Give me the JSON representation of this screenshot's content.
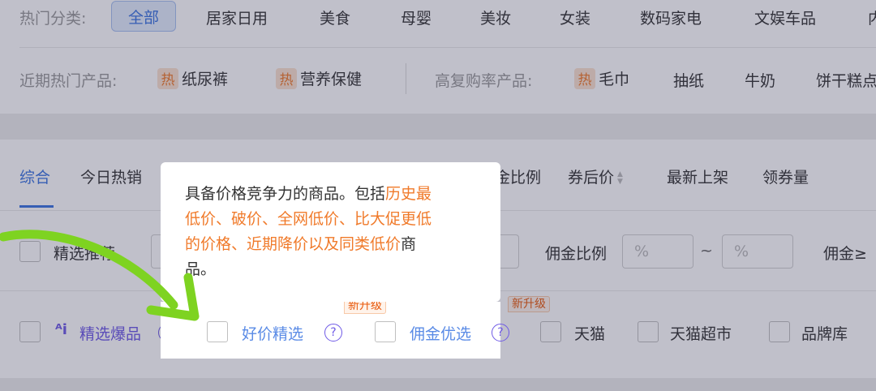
{
  "categories": {
    "label": "热门分类:",
    "items": [
      "全部",
      "居家日用",
      "美食",
      "母婴",
      "美妆",
      "女装",
      "数码家电",
      "文娱车品",
      "内"
    ]
  },
  "hot_products": {
    "recent_label": "近期热门产品:",
    "hot_badge": "热",
    "recent_items": [
      "纸尿裤",
      "营养保健"
    ],
    "repurchase_label": "高复购率产品:",
    "repurchase_items": [
      "毛巾",
      "抽纸",
      "牛奶",
      "饼干糕点"
    ]
  },
  "sort_tabs": [
    "综合",
    "今日热销",
    "金比例",
    "券后价",
    "最新上架",
    "领券量"
  ],
  "filter_row1": {
    "recommend_label": "精选推荐",
    "commission_ratio_label": "佣金比例",
    "percent_placeholder": "%",
    "range_sep": "~",
    "commission_gte_label": "佣金≥"
  },
  "filter_row2": {
    "ai_logo": "ᴬi",
    "hot_picks_label": "精选爆品",
    "good_price_label": "好价精选",
    "commission_pick_label": "佣金优选",
    "new_tag": "新升级",
    "tmall_label": "天猫",
    "tmall_super_label": "天猫超市",
    "brand_label": "品牌库",
    "help_glyph": "?"
  },
  "tooltip": {
    "line1_plain": "具备价格竞争力的商品。包括",
    "line1_hl": "历史最",
    "line2_hl": "低价、破价、全网低价、比大促更低",
    "line3_hl": "的价格、近期降价以及同类低价",
    "line3_plain": "商",
    "line4_plain": "品。"
  },
  "colors": {
    "accent_blue": "#3a73e0",
    "purple": "#6e59e6",
    "orange": "#f07a2a",
    "arrow_green": "#7ed321"
  }
}
